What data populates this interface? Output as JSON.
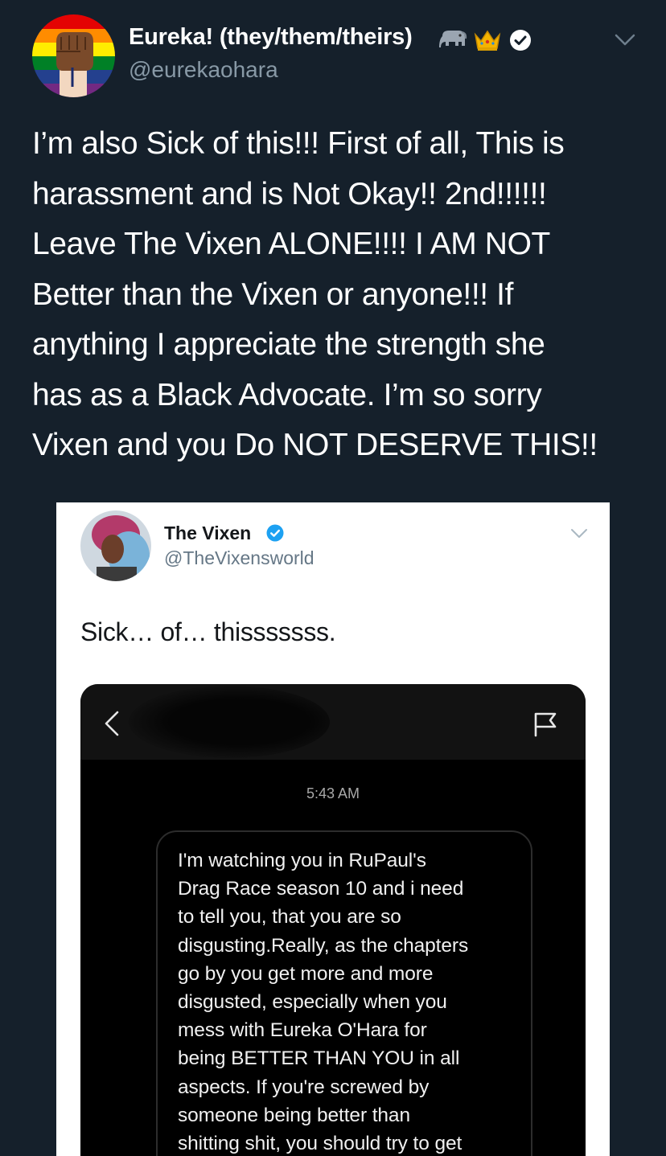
{
  "tweet": {
    "author": {
      "display_name": "Eureka! (they/them/theirs)",
      "handle": "@eurekaohara",
      "emojis": [
        "elephant",
        "crown"
      ],
      "verified": true,
      "avatar": "pride-raised-fist"
    },
    "text_lines": [
      "I’m also Sick of this!!! First of all, This is",
      "harassment and is Not Okay!! 2nd!!!!!!",
      "Leave The Vixen ALONE!!!! I AM NOT",
      "Better than the Vixen or anyone!!! If",
      "anything I appreciate the strength she",
      "has as a Black Advocate. I’m so sorry",
      "Vixen and you Do NOT DESERVE THIS!!"
    ]
  },
  "quoted_screenshot": {
    "author": {
      "display_name": "The Vixen",
      "handle": "@TheVixensworld",
      "verified": true
    },
    "text": "Sick… of… thisssssss.",
    "dm": {
      "time": "5:43 AM",
      "message_lines": [
        "I'm watching you in RuPaul's",
        "Drag Race season 10 and i need",
        "to tell you, that you are so",
        "disgusting.Really, as the chapters",
        "go by you get more and more",
        "disgusted, especially when you",
        "mess with Eureka O'Hara for",
        "being BETTER THAN YOU in all",
        "aspects. If you're screwed by",
        "someone being better than",
        "shitting shit, you should try to get"
      ]
    }
  },
  "colors": {
    "background": "#15202b",
    "text": "#ffffff",
    "secondary_text": "#8899a6",
    "verified_blue": "#1da1f2"
  }
}
